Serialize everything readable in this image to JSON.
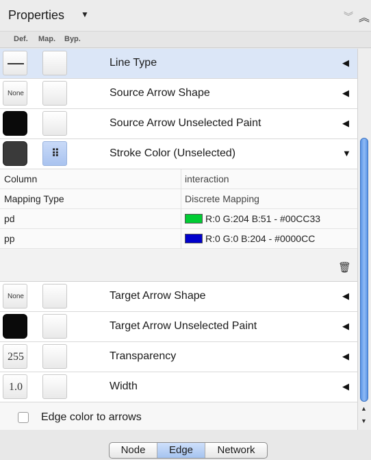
{
  "header": {
    "title": "Properties",
    "caret_icon": "caret-down-icon",
    "collapse_all_icon": "double-chevron-down-icon",
    "expand_all_icon": "double-chevron-up-icon"
  },
  "columns": {
    "def": "Def.",
    "map": "Map.",
    "byp": "Byp."
  },
  "properties_top": [
    {
      "label": "Line Type",
      "def": "",
      "def_style": "line"
    },
    {
      "label": "Source Arrow Shape",
      "def": "None",
      "def_style": "text"
    },
    {
      "label": "Source Arrow Unselected Paint",
      "def": "",
      "def_style": "black"
    },
    {
      "label": "Stroke Color (Unselected)",
      "def": "",
      "def_style": "gray",
      "map_glyph": "⠿"
    }
  ],
  "mapping": {
    "column_key": "Column",
    "column_value": "interaction",
    "type_key": "Mapping Type",
    "type_value": "Discrete Mapping",
    "entries": [
      {
        "key": "pd",
        "color": "#00CC33",
        "value": "R:0 G:204 B:51 - #00CC33"
      },
      {
        "key": "pp",
        "color": "#0000CC",
        "value": "R:0 G:0 B:204 - #0000CC"
      }
    ]
  },
  "properties_bottom": [
    {
      "label": "Target Arrow Shape",
      "def": "None",
      "def_style": "text"
    },
    {
      "label": "Target Arrow Unselected Paint",
      "def": "",
      "def_style": "black"
    },
    {
      "label": "Transparency",
      "def": "255",
      "def_style": "num"
    },
    {
      "label": "Width",
      "def": "1.0",
      "def_style": "num"
    }
  ],
  "checkbox": {
    "label": "Edge color to arrows",
    "checked": false
  },
  "tabs": [
    {
      "label": "Node",
      "active": false
    },
    {
      "label": "Edge",
      "active": true
    },
    {
      "label": "Network",
      "active": false
    }
  ],
  "icons": {
    "collapsed_arrow": "◀",
    "expanded_arrow": "▼",
    "trash": "trash-icon"
  }
}
